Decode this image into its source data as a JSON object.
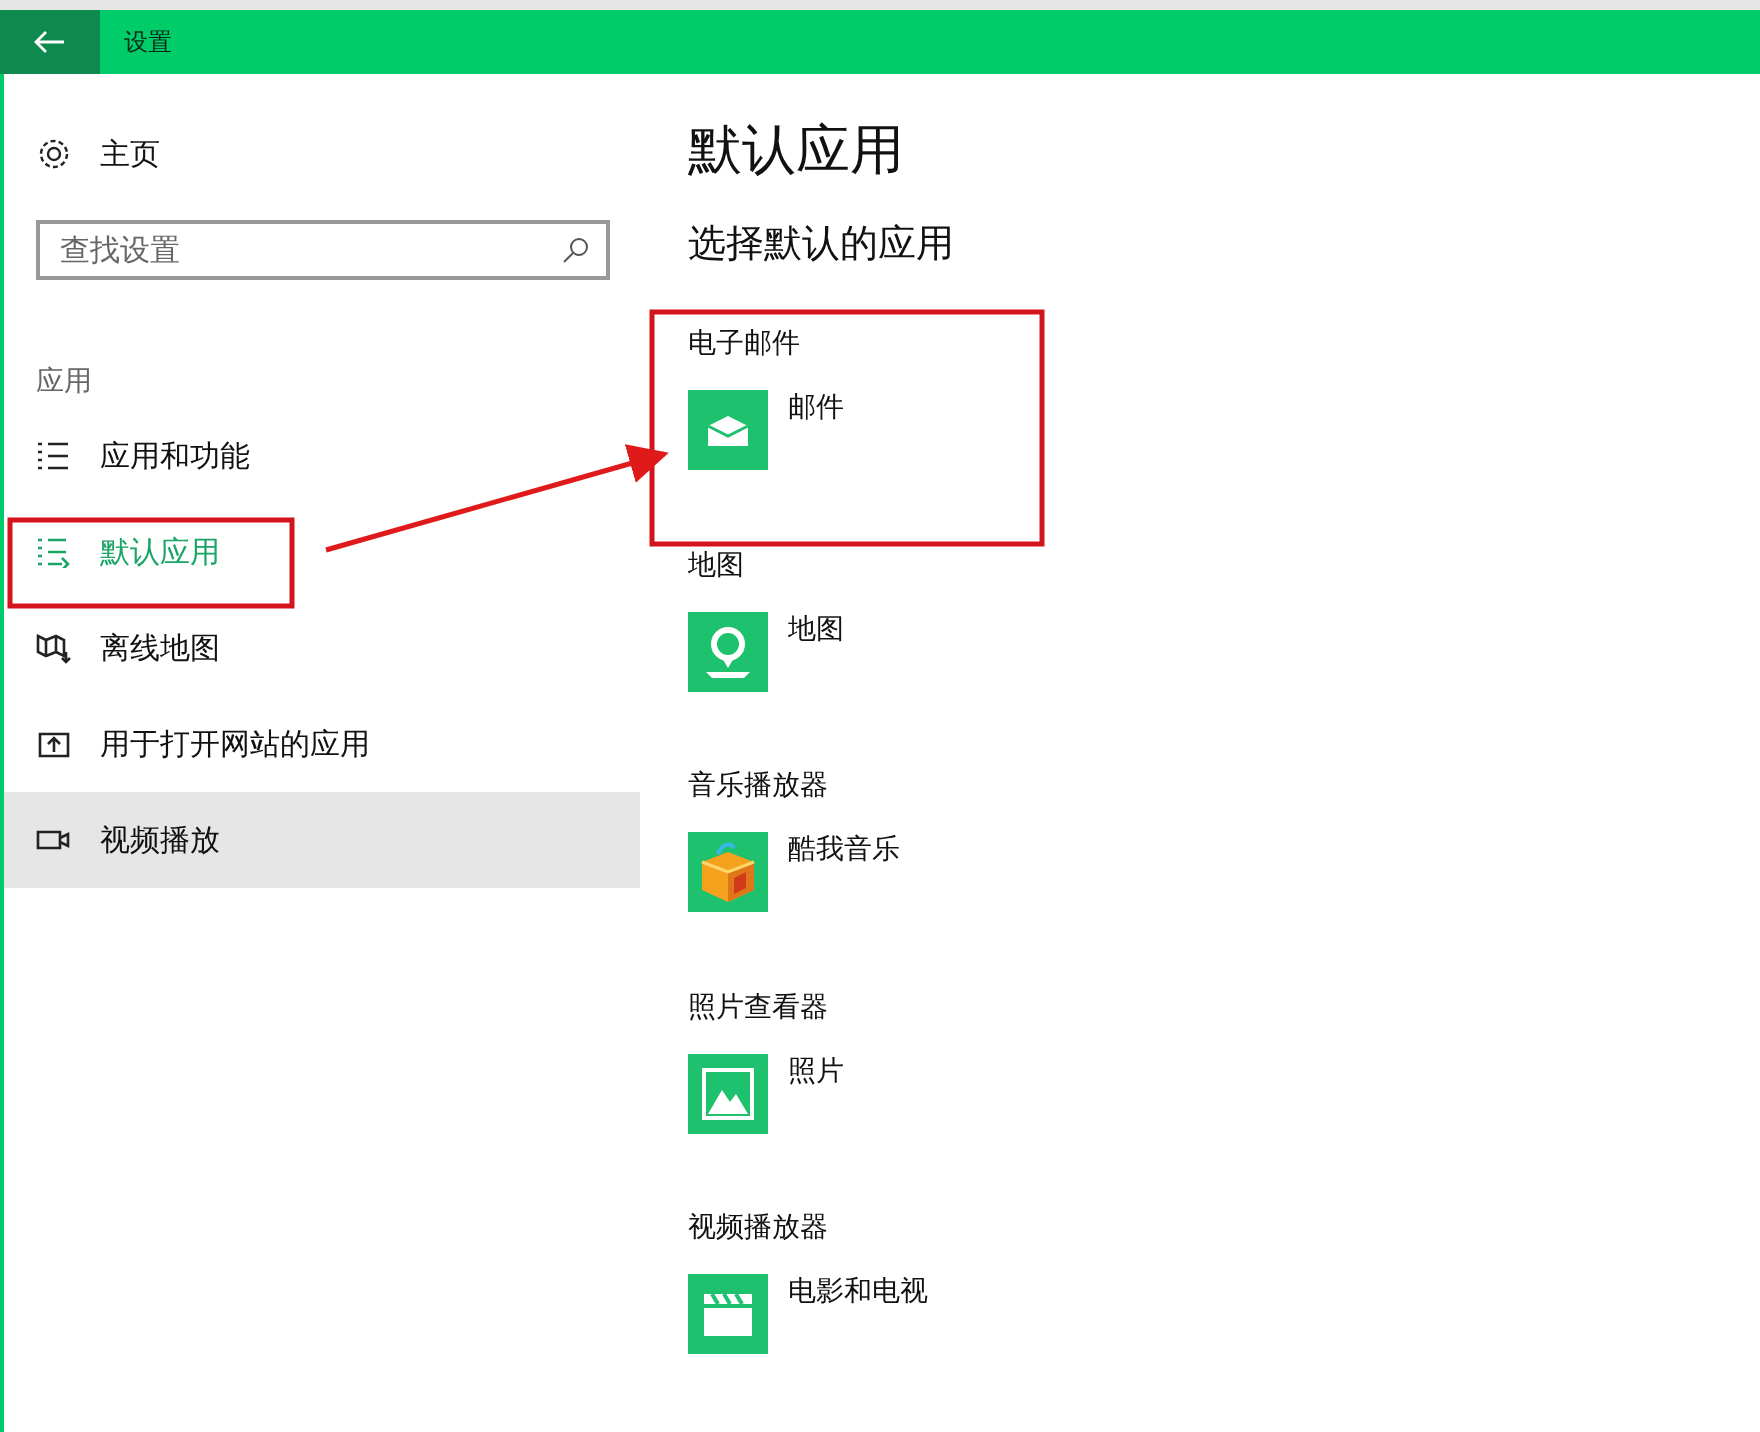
{
  "window": {
    "title": "设置"
  },
  "sidebar": {
    "home": "主页",
    "search": {
      "placeholder": "查找设置"
    },
    "section": "应用",
    "items": [
      {
        "label": "应用和功能",
        "kind": "list",
        "selected": false,
        "hovered": false
      },
      {
        "label": "默认应用",
        "kind": "defaults",
        "selected": true,
        "hovered": false
      },
      {
        "label": "离线地图",
        "kind": "map",
        "selected": false,
        "hovered": false
      },
      {
        "label": "用于打开网站的应用",
        "kind": "web",
        "selected": false,
        "hovered": false
      },
      {
        "label": "视频播放",
        "kind": "video",
        "selected": false,
        "hovered": true
      }
    ]
  },
  "content": {
    "title": "默认应用",
    "subtitle": "选择默认的应用",
    "groups": [
      {
        "label": "电子邮件",
        "app": "邮件",
        "kind": "mail"
      },
      {
        "label": "地图",
        "app": "地图",
        "kind": "map"
      },
      {
        "label": "音乐播放器",
        "app": "酷我音乐",
        "kind": "music"
      },
      {
        "label": "照片查看器",
        "app": "照片",
        "kind": "photo"
      },
      {
        "label": "视频播放器",
        "app": "电影和电视",
        "kind": "video"
      }
    ]
  }
}
